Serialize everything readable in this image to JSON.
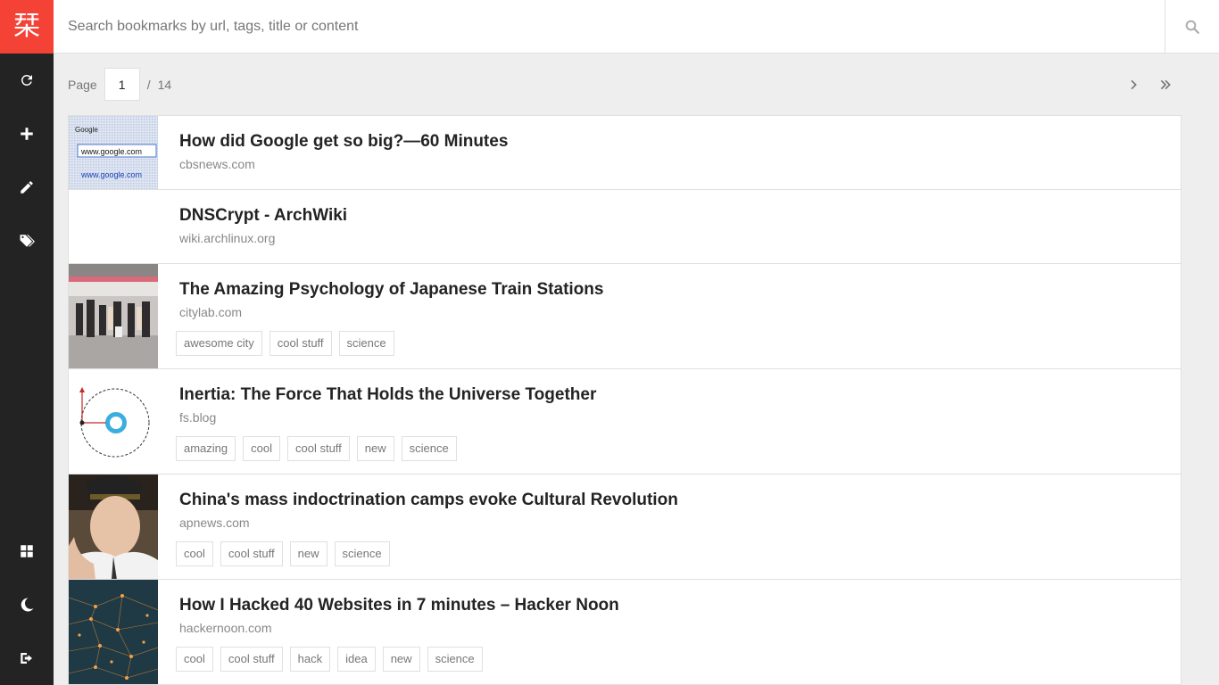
{
  "app": {
    "logo_glyph": "栞",
    "accent": "#f44336",
    "sidebar_bg": "#232323"
  },
  "sidebar": {
    "top_items": [
      "refresh-icon",
      "add-icon",
      "edit-icon",
      "tags-icon"
    ],
    "bottom_items": [
      "grid-icon",
      "moon-icon",
      "logout-icon"
    ]
  },
  "search": {
    "placeholder": "Search bookmarks by url, tags, title or content",
    "icon": "search-icon"
  },
  "pagination": {
    "label": "Page",
    "current": "1",
    "separator": "/",
    "total": "14",
    "next_icon": "chevron-right-icon",
    "last_icon": "double-chevron-right-icon"
  },
  "bookmarks": [
    {
      "title": "How did Google get so big?—60 Minutes",
      "host": "cbsnews.com",
      "tags": []
    },
    {
      "title": "DNSCrypt - ArchWiki",
      "host": "wiki.archlinux.org",
      "tags": []
    },
    {
      "title": "The Amazing Psychology of Japanese Train Stations",
      "host": "citylab.com",
      "tags": [
        "awesome city",
        "cool stuff",
        "science"
      ]
    },
    {
      "title": "Inertia: The Force That Holds the Universe Together",
      "host": "fs.blog",
      "tags": [
        "amazing",
        "cool",
        "cool stuff",
        "new",
        "science"
      ]
    },
    {
      "title": "China's mass indoctrination camps evoke Cultural Revolution",
      "host": "apnews.com",
      "tags": [
        "cool",
        "cool stuff",
        "new",
        "science"
      ]
    },
    {
      "title": "How I Hacked 40 Websites in 7 minutes – Hacker Noon",
      "host": "hackernoon.com",
      "tags": [
        "cool",
        "cool stuff",
        "hack",
        "idea",
        "new",
        "science"
      ]
    }
  ],
  "thumb_text": {
    "google_1": "Google",
    "google_2": "www.google.com",
    "google_3": "www.google.com"
  }
}
